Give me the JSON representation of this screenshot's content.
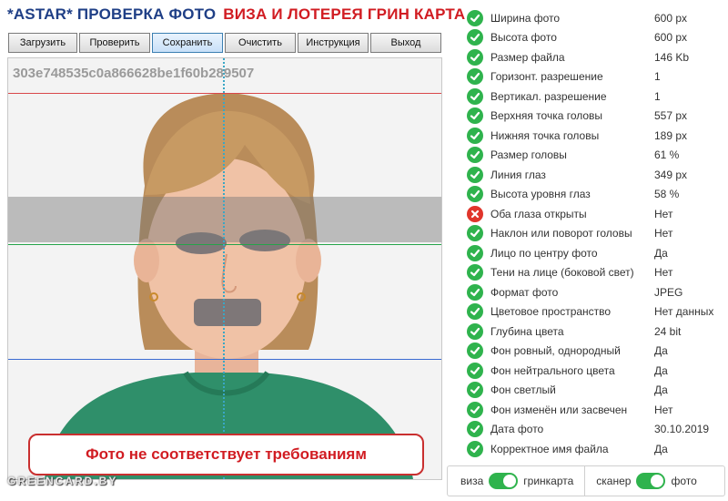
{
  "title": {
    "part1": "*ASTAR* ПРОВЕРКА ФОТО",
    "part2": "ВИЗА И ЛОТЕРЕЯ ГРИН КАРТА"
  },
  "toolbar": {
    "buttons": [
      "Загрузить",
      "Проверить",
      "Сохранить",
      "Очистить",
      "Инструкция",
      "Выход"
    ],
    "active": "Сохранить"
  },
  "photo": {
    "hash": "303e748535c0a866628be1f60b289507",
    "warning": "Фото не соответствует требованиям",
    "watermark": "GREENCARD.BY"
  },
  "checks": [
    {
      "label": "Ширина фото",
      "value": "600 px",
      "status": "ok"
    },
    {
      "label": "Высота фото",
      "value": "600 px",
      "status": "ok"
    },
    {
      "label": "Размер файла",
      "value": "146 Kb",
      "status": "ok"
    },
    {
      "label": "Горизонт. разрешение",
      "value": "1",
      "status": "ok"
    },
    {
      "label": "Вертикал. разрешение",
      "value": "1",
      "status": "ok"
    },
    {
      "label": "Верхняя точка головы",
      "value": "557 px",
      "status": "ok"
    },
    {
      "label": "Нижняя точка головы",
      "value": "189 px",
      "status": "ok"
    },
    {
      "label": "Размер головы",
      "value": "61 %",
      "status": "ok"
    },
    {
      "label": "Линия глаз",
      "value": "349 px",
      "status": "ok"
    },
    {
      "label": "Высота уровня глаз",
      "value": "58 %",
      "status": "ok"
    },
    {
      "label": "Оба глаза открыты",
      "value": "Нет",
      "status": "fail"
    },
    {
      "label": "Наклон или поворот головы",
      "value": "Нет",
      "status": "ok"
    },
    {
      "label": "Лицо по центру фото",
      "value": "Да",
      "status": "ok"
    },
    {
      "label": "Тени на лице (боковой свет)",
      "value": "Нет",
      "status": "ok"
    },
    {
      "label": "Формат фото",
      "value": "JPEG",
      "status": "ok"
    },
    {
      "label": "Цветовое пространство",
      "value": "Нет данных",
      "status": "ok"
    },
    {
      "label": "Глубина цвета",
      "value": "24 bit",
      "status": "ok"
    },
    {
      "label": "Фон ровный, однородный",
      "value": "Да",
      "status": "ok"
    },
    {
      "label": "Фон нейтрального цвета",
      "value": "Да",
      "status": "ok"
    },
    {
      "label": "Фон светлый",
      "value": "Да",
      "status": "ok"
    },
    {
      "label": "Фон изменён или засвечен",
      "value": "Нет",
      "status": "ok"
    },
    {
      "label": "Дата фото",
      "value": "30.10.2019",
      "status": "ok"
    },
    {
      "label": "Корректное имя файла",
      "value": "Да",
      "status": "ok"
    }
  ],
  "modes": {
    "left_off": "виза",
    "left_on": "гринкарта",
    "left_state": "on",
    "right_off": "сканер",
    "right_on": "фото",
    "right_state": "on"
  },
  "colors": {
    "ok": "#2fb34d",
    "fail": "#e0352b",
    "brand_blue": "#1f3f86",
    "brand_red": "#d11c22"
  }
}
